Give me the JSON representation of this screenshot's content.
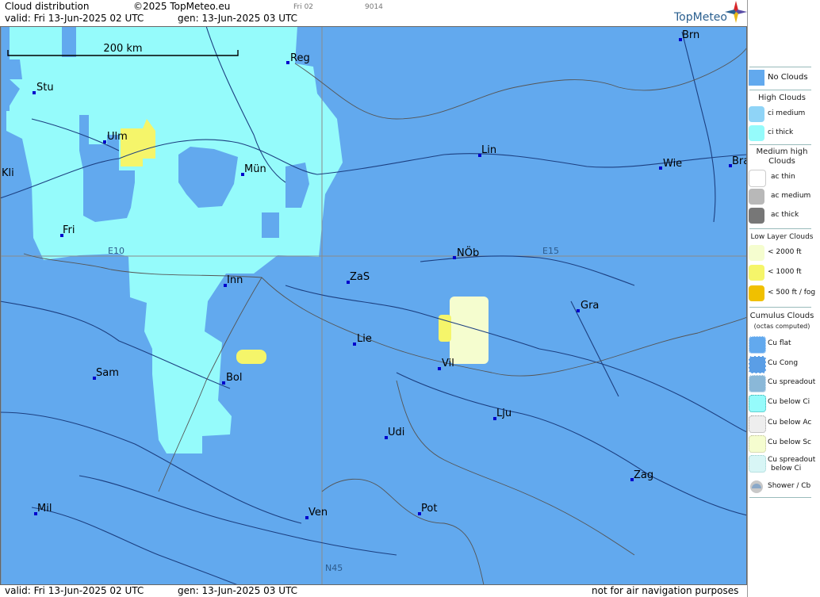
{
  "header": {
    "title": "Cloud distribution",
    "copyright": "©2025 TopMeteo.eu",
    "day_tag": "Fri 02",
    "code": "9014",
    "valid": "valid:  Fri  13-Jun-2025  02 UTC",
    "gen": "gen: 13-Jun-2025 03 UTC",
    "brand": "TopMeteo"
  },
  "footer": {
    "valid": "valid:  Fri  13-Jun-2025  02 UTC",
    "gen": "gen: 13-Jun-2025 03 UTC",
    "disclaimer": "not for air navigation purposes"
  },
  "map": {
    "scale_label": "200 km",
    "grid_labels": {
      "e10": "E10",
      "e15": "E15",
      "n45": "N45"
    },
    "cities": [
      {
        "id": "brn",
        "label": "Brn"
      },
      {
        "id": "reg",
        "label": "Reg"
      },
      {
        "id": "stu",
        "label": "Stu"
      },
      {
        "id": "ulm",
        "label": "Ulm"
      },
      {
        "id": "lin",
        "label": "Lin"
      },
      {
        "id": "wie",
        "label": "Wie"
      },
      {
        "id": "bra",
        "label": "Bra"
      },
      {
        "id": "kli",
        "label": "Kli"
      },
      {
        "id": "mun",
        "label": "Mün"
      },
      {
        "id": "fri",
        "label": "Fri"
      },
      {
        "id": "nob",
        "label": "NÖb"
      },
      {
        "id": "inn",
        "label": "Inn"
      },
      {
        "id": "zas",
        "label": "ZaS"
      },
      {
        "id": "gra",
        "label": "Gra"
      },
      {
        "id": "lie",
        "label": "Lie"
      },
      {
        "id": "vil",
        "label": "Vil"
      },
      {
        "id": "sam",
        "label": "Sam"
      },
      {
        "id": "bol",
        "label": "Bol"
      },
      {
        "id": "lju",
        "label": "Lju"
      },
      {
        "id": "udi",
        "label": "Udi"
      },
      {
        "id": "zag",
        "label": "Zag"
      },
      {
        "id": "mil",
        "label": "Mil"
      },
      {
        "id": "ven",
        "label": "Ven"
      },
      {
        "id": "pot",
        "label": "Pot"
      }
    ]
  },
  "legend": {
    "no_clouds": "No Clouds",
    "high_title": "High Clouds",
    "ci_medium": "ci medium",
    "ci_thick": "ci thick",
    "medium_title_1": "Medium high",
    "medium_title_2": "Clouds",
    "ac_thin": "ac thin",
    "ac_medium": "ac medium",
    "ac_thick": "ac thick",
    "low_title": "Low Layer Clouds",
    "low_2000": "< 2000 ft",
    "low_1000": "< 1000 ft",
    "low_500": "< 500 ft / fog",
    "cu_title": "Cumulus Clouds",
    "cu_sub": "(octas computed)",
    "cu_flat": "Cu flat",
    "cu_cong": "Cu Cong",
    "cu_spreadout": "Cu spreadout",
    "cu_below_ci": "Cu below Ci",
    "cu_below_ac": "Cu below Ac",
    "cu_below_sc": "Cu below Sc",
    "cu_spreadout_ci_1": "Cu spreadout",
    "cu_spreadout_ci_2": "below Ci",
    "shower": "Shower / Cb"
  },
  "colors": {
    "no_clouds": "#62a9ee",
    "ci_thick": "#95fbfb",
    "ci_medium": "#8fd4f7",
    "low_2000": "#f5fdcf",
    "low_1000": "#f5f56a",
    "low_500": "#f0c000",
    "brand": "#2a5f8f"
  }
}
